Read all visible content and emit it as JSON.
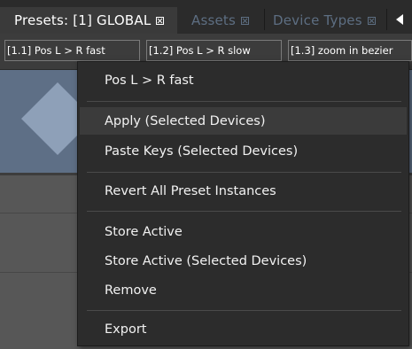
{
  "tabs": [
    {
      "label": "Presets: [1] GLOBAL",
      "active": true
    },
    {
      "label": "Assets",
      "active": false
    },
    {
      "label": "Device Types",
      "active": false
    }
  ],
  "preset_buttons": [
    {
      "label": "[1.1] Pos L > R fast"
    },
    {
      "label": "[1.2] Pos L > R slow"
    },
    {
      "label": "[1.3] zoom in bezier"
    }
  ],
  "context_menu": {
    "title": "Pos L > R fast",
    "groups": [
      [
        "Apply (Selected Devices)",
        "Paste Keys (Selected Devices)"
      ],
      [
        "Revert All Preset Instances"
      ],
      [
        "Store Active",
        "Store Active (Selected Devices)",
        "Remove"
      ],
      [
        "Export"
      ]
    ],
    "highlighted_item": "Apply (Selected Devices)"
  },
  "colors": {
    "tab_bar_bg": "#2b2b2b",
    "active_tab_bg": "#3a3a3a",
    "inactive_tab_text": "#5d6e82",
    "preset_tile": "#5e6f86",
    "preset_diamond": "#8ea0b8",
    "menu_bg": "#2c2c2c"
  }
}
